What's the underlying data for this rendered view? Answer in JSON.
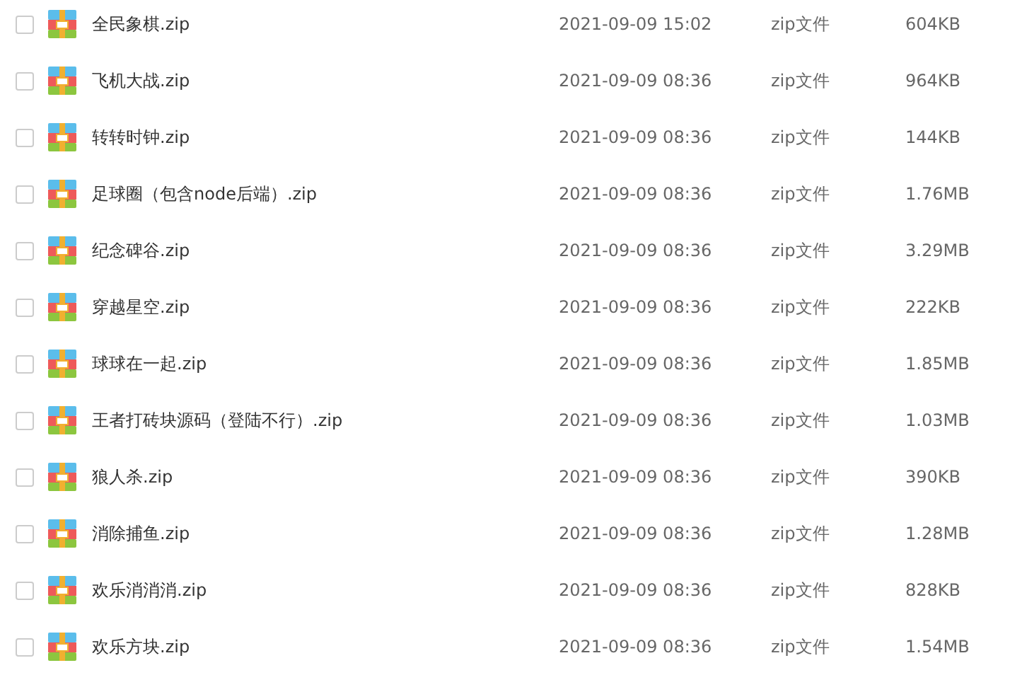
{
  "files": [
    {
      "name": "全民象棋.zip",
      "date": "2021-09-09 15:02",
      "type": "zip文件",
      "size": "604KB",
      "checked": false
    },
    {
      "name": "飞机大战.zip",
      "date": "2021-09-09 08:36",
      "type": "zip文件",
      "size": "964KB",
      "checked": false
    },
    {
      "name": "转转时钟.zip",
      "date": "2021-09-09 08:36",
      "type": "zip文件",
      "size": "144KB",
      "checked": false
    },
    {
      "name": "足球圈（包含node后端）.zip",
      "date": "2021-09-09 08:36",
      "type": "zip文件",
      "size": "1.76MB",
      "checked": false
    },
    {
      "name": "纪念碑谷.zip",
      "date": "2021-09-09 08:36",
      "type": "zip文件",
      "size": "3.29MB",
      "checked": false
    },
    {
      "name": "穿越星空.zip",
      "date": "2021-09-09 08:36",
      "type": "zip文件",
      "size": "222KB",
      "checked": false
    },
    {
      "name": "球球在一起.zip",
      "date": "2021-09-09 08:36",
      "type": "zip文件",
      "size": "1.85MB",
      "checked": false
    },
    {
      "name": "王者打砖块源码（登陆不行）.zip",
      "date": "2021-09-09 08:36",
      "type": "zip文件",
      "size": "1.03MB",
      "checked": false
    },
    {
      "name": "狼人杀.zip",
      "date": "2021-09-09 08:36",
      "type": "zip文件",
      "size": "390KB",
      "checked": false
    },
    {
      "name": "消除捕鱼.zip",
      "date": "2021-09-09 08:36",
      "type": "zip文件",
      "size": "1.28MB",
      "checked": false
    },
    {
      "name": "欢乐消消消.zip",
      "date": "2021-09-09 08:36",
      "type": "zip文件",
      "size": "828KB",
      "checked": false
    },
    {
      "name": "欢乐方块.zip",
      "date": "2021-09-09 08:36",
      "type": "zip文件",
      "size": "1.54MB",
      "checked": false
    }
  ]
}
